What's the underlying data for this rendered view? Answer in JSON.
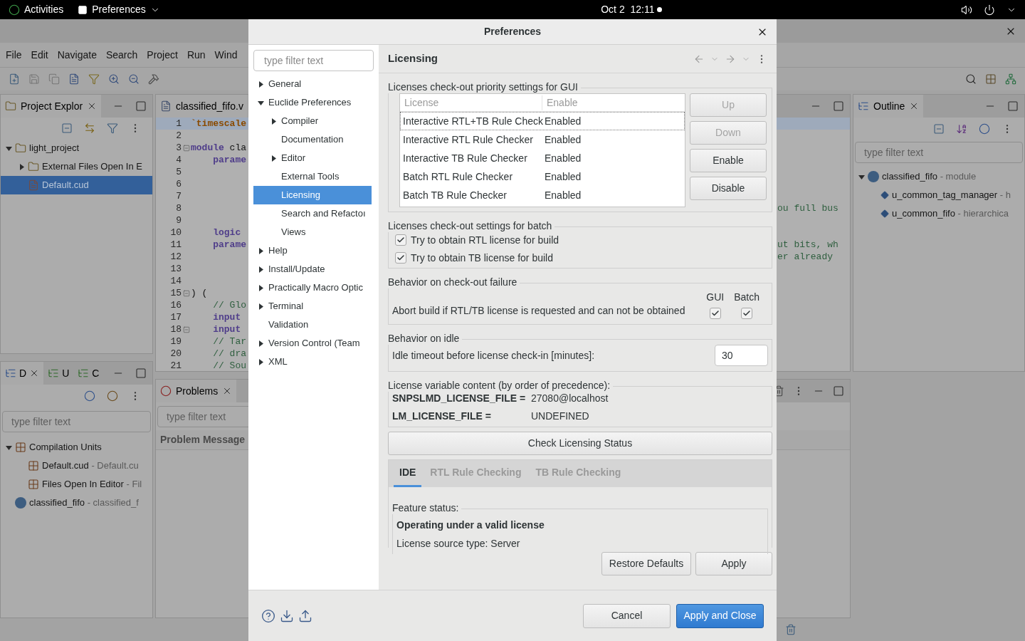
{
  "top_bar": {
    "activities": "Activities",
    "app_menu": "Preferences",
    "clock": "Oct 2  12:11"
  },
  "ide": {
    "menu": [
      "File",
      "Edit",
      "Navigate",
      "Search",
      "Project",
      "Run",
      "Wind"
    ],
    "project_explorer": {
      "tab": "Project Explor",
      "tree": [
        {
          "label": "light_project",
          "kind": "project",
          "expanded": true,
          "selected": false,
          "children": [
            {
              "label": "External Files Open In E",
              "kind": "folder",
              "expanded": false,
              "selected": false
            },
            {
              "label": "Default.cud",
              "kind": "file",
              "selected": true
            }
          ]
        }
      ]
    },
    "design_panel": {
      "tabs": [
        {
          "label": "D",
          "selected": true
        },
        {
          "label": "U",
          "selected": false
        },
        {
          "label": "C",
          "selected": false
        }
      ],
      "filter_placeholder": "type filter text",
      "tree": [
        {
          "label": "Compilation Units",
          "kind": "unit",
          "expanded": true,
          "children": [
            {
              "label": "Default.cud",
              "detail": " - Default.cu",
              "kind": "unit"
            },
            {
              "label": "Files Open In Editor",
              "detail": " - Fil",
              "kind": "unit"
            }
          ]
        },
        {
          "label": "classified_fifo",
          "detail": " - classified_f",
          "kind": "module"
        }
      ]
    },
    "editor": {
      "tab": "classified_fifo.v",
      "lines": [
        {
          "number": "1",
          "fold": false,
          "highlighted": true,
          "tokens": [
            {
              "text": "`timescale",
              "kind": "directive"
            }
          ]
        },
        {
          "number": "2",
          "fold": false,
          "highlighted": false
        },
        {
          "number": "3",
          "fold": true,
          "highlighted": false,
          "tokens": [
            {
              "text": "module",
              "kind": "keyword"
            },
            {
              "text": " cla",
              "kind": "plain"
            }
          ]
        },
        {
          "number": "4",
          "fold": false,
          "highlighted": false,
          "tokens": [
            {
              "text": "    parame",
              "kind": "keyword"
            }
          ]
        },
        {
          "number": "5",
          "fold": false,
          "highlighted": false
        },
        {
          "number": "6",
          "fold": false,
          "highlighted": false
        },
        {
          "number": "7",
          "fold": false,
          "highlighted": false
        },
        {
          "number": "8",
          "fold": false,
          "highlighted": false,
          "tail": "ou full bus"
        },
        {
          "number": "9",
          "fold": false,
          "highlighted": false
        },
        {
          "number": "10",
          "fold": false,
          "highlighted": false,
          "tokens": [
            {
              "text": "    logic",
              "kind": "keyword"
            }
          ]
        },
        {
          "number": "11",
          "fold": false,
          "highlighted": false,
          "tokens": [
            {
              "text": "    parame",
              "kind": "keyword"
            }
          ],
          "tail": "ut bits, wh"
        },
        {
          "number": "12",
          "fold": false,
          "highlighted": false,
          "tail": "er already"
        },
        {
          "number": "13",
          "fold": false,
          "highlighted": false
        },
        {
          "number": "14",
          "fold": false,
          "highlighted": false
        },
        {
          "number": "15",
          "fold": true,
          "highlighted": false,
          "tokens": [
            {
              "text": ") (",
              "kind": "plain"
            }
          ]
        },
        {
          "number": "16",
          "fold": false,
          "highlighted": false,
          "tokens": [
            {
              "text": "    // Glo",
              "kind": "comment"
            }
          ]
        },
        {
          "number": "17",
          "fold": false,
          "highlighted": false,
          "tokens": [
            {
              "text": "    input",
              "kind": "keyword"
            }
          ]
        },
        {
          "number": "18",
          "fold": true,
          "highlighted": false,
          "tokens": [
            {
              "text": "    input",
              "kind": "keyword"
            }
          ]
        },
        {
          "number": "19",
          "fold": false,
          "highlighted": false,
          "tokens": [
            {
              "text": "    // Tar",
              "kind": "comment"
            }
          ]
        },
        {
          "number": "20",
          "fold": false,
          "highlighted": false,
          "tokens": [
            {
              "text": "    // dra",
              "kind": "comment"
            }
          ]
        },
        {
          "number": "21",
          "fold": false,
          "highlighted": false,
          "tokens": [
            {
              "text": "    // Sou",
              "kind": "comment"
            }
          ]
        }
      ]
    },
    "problems": {
      "tab": "Problems",
      "filter_placeholder": "type filter text",
      "column": "Problem Message"
    },
    "outline": {
      "tab": "Outline",
      "filter_placeholder": "type filter text",
      "tree": [
        {
          "label": "classified_fifo",
          "detail": " - module",
          "kind": "module",
          "expanded": true,
          "children": [
            {
              "label": "u_common_tag_manager",
              "detail": " - h",
              "kind": "instance"
            },
            {
              "label": "u_common_fifo",
              "detail": " - hierarchica",
              "kind": "instance"
            }
          ]
        }
      ]
    }
  },
  "dialog": {
    "title": "Preferences",
    "filter_placeholder": "type filter text",
    "tree": [
      {
        "label": "General",
        "kind": "folder",
        "expanded": false,
        "selected": false
      },
      {
        "label": "Euclide Preferences",
        "kind": "folder",
        "expanded": true,
        "selected": false,
        "children": [
          {
            "label": "Compiler",
            "kind": "folder",
            "expanded": false,
            "selected": false
          },
          {
            "label": "Documentation",
            "kind": "leaf",
            "selected": false
          },
          {
            "label": "Editor",
            "kind": "folder",
            "expanded": false,
            "selected": false
          },
          {
            "label": "External Tools",
            "kind": "leaf",
            "selected": false
          },
          {
            "label": "Licensing",
            "kind": "leaf",
            "selected": true
          },
          {
            "label": "Search and Refactoı",
            "kind": "leaf",
            "selected": false
          },
          {
            "label": "Views",
            "kind": "leaf",
            "selected": false
          }
        ]
      },
      {
        "label": "Help",
        "kind": "folder",
        "expanded": false,
        "selected": false
      },
      {
        "label": "Install/Update",
        "kind": "folder",
        "expanded": false,
        "selected": false
      },
      {
        "label": "Practically Macro Optic",
        "kind": "folder",
        "expanded": false,
        "selected": false
      },
      {
        "label": "Terminal",
        "kind": "folder",
        "expanded": false,
        "selected": false
      },
      {
        "label": "Validation",
        "kind": "leaf",
        "selected": false
      },
      {
        "label": "Version Control (Team",
        "kind": "folder",
        "expanded": false,
        "selected": false
      },
      {
        "label": "XML",
        "kind": "folder",
        "expanded": false,
        "selected": false
      }
    ],
    "page": {
      "title": "Licensing",
      "gui_group": {
        "title": "Licenses check-out priority settings for GUI",
        "columns": [
          "License",
          "Enable"
        ],
        "rows": [
          {
            "license": "Interactive RTL+TB Rule Check",
            "enable": "Enabled",
            "selected": true
          },
          {
            "license": "Interactive RTL Rule Checker",
            "enable": "Enabled",
            "selected": false
          },
          {
            "license": "Interactive TB Rule Checker",
            "enable": "Enabled",
            "selected": false
          },
          {
            "license": "Batch RTL Rule Checker",
            "enable": "Enabled",
            "selected": false
          },
          {
            "license": "Batch TB Rule Checker",
            "enable": "Enabled",
            "selected": false
          }
        ],
        "buttons": [
          {
            "label": "Up",
            "disabled": true
          },
          {
            "label": "Down",
            "disabled": true
          },
          {
            "label": "Enable",
            "disabled": false
          },
          {
            "label": "Disable",
            "disabled": false
          }
        ]
      },
      "batch_group": {
        "title": "Licenses check-out settings for batch",
        "options": [
          {
            "label": "Try to obtain RTL license for build",
            "checked": true
          },
          {
            "label": "Try to obtain TB license for build",
            "checked": true
          }
        ]
      },
      "failure_group": {
        "title": "Behavior on check-out failure",
        "columns": [
          "GUI",
          "Batch"
        ],
        "label": "Abort build if RTL/TB license is requested and can not be obtained",
        "gui_checked": true,
        "batch_checked": true
      },
      "idle_group": {
        "title": "Behavior on idle",
        "label": "Idle timeout before license check-in [minutes]:",
        "value": "30"
      },
      "variables_group": {
        "title": "License variable content (by order of precedence):",
        "rows": [
          {
            "name": "SNPSLMD_LICENSE_FILE =",
            "value": "27080@localhost"
          },
          {
            "name": "LM_LICENSE_FILE =",
            "value": "UNDEFINED"
          }
        ]
      },
      "check_button": "Check Licensing Status",
      "tabs": [
        {
          "label": "IDE",
          "selected": true
        },
        {
          "label": "RTL Rule Checking",
          "selected": false
        },
        {
          "label": "TB Rule Checking",
          "selected": false
        }
      ],
      "feature": {
        "title": "Feature status:",
        "status": "Operating under a valid license",
        "source": "License source type: Server"
      },
      "buttons": [
        "Restore Defaults",
        "Apply"
      ]
    },
    "footer_buttons": [
      {
        "label": "Cancel",
        "kind": "secondary"
      },
      {
        "label": "Apply and Close",
        "kind": "primary"
      }
    ]
  }
}
